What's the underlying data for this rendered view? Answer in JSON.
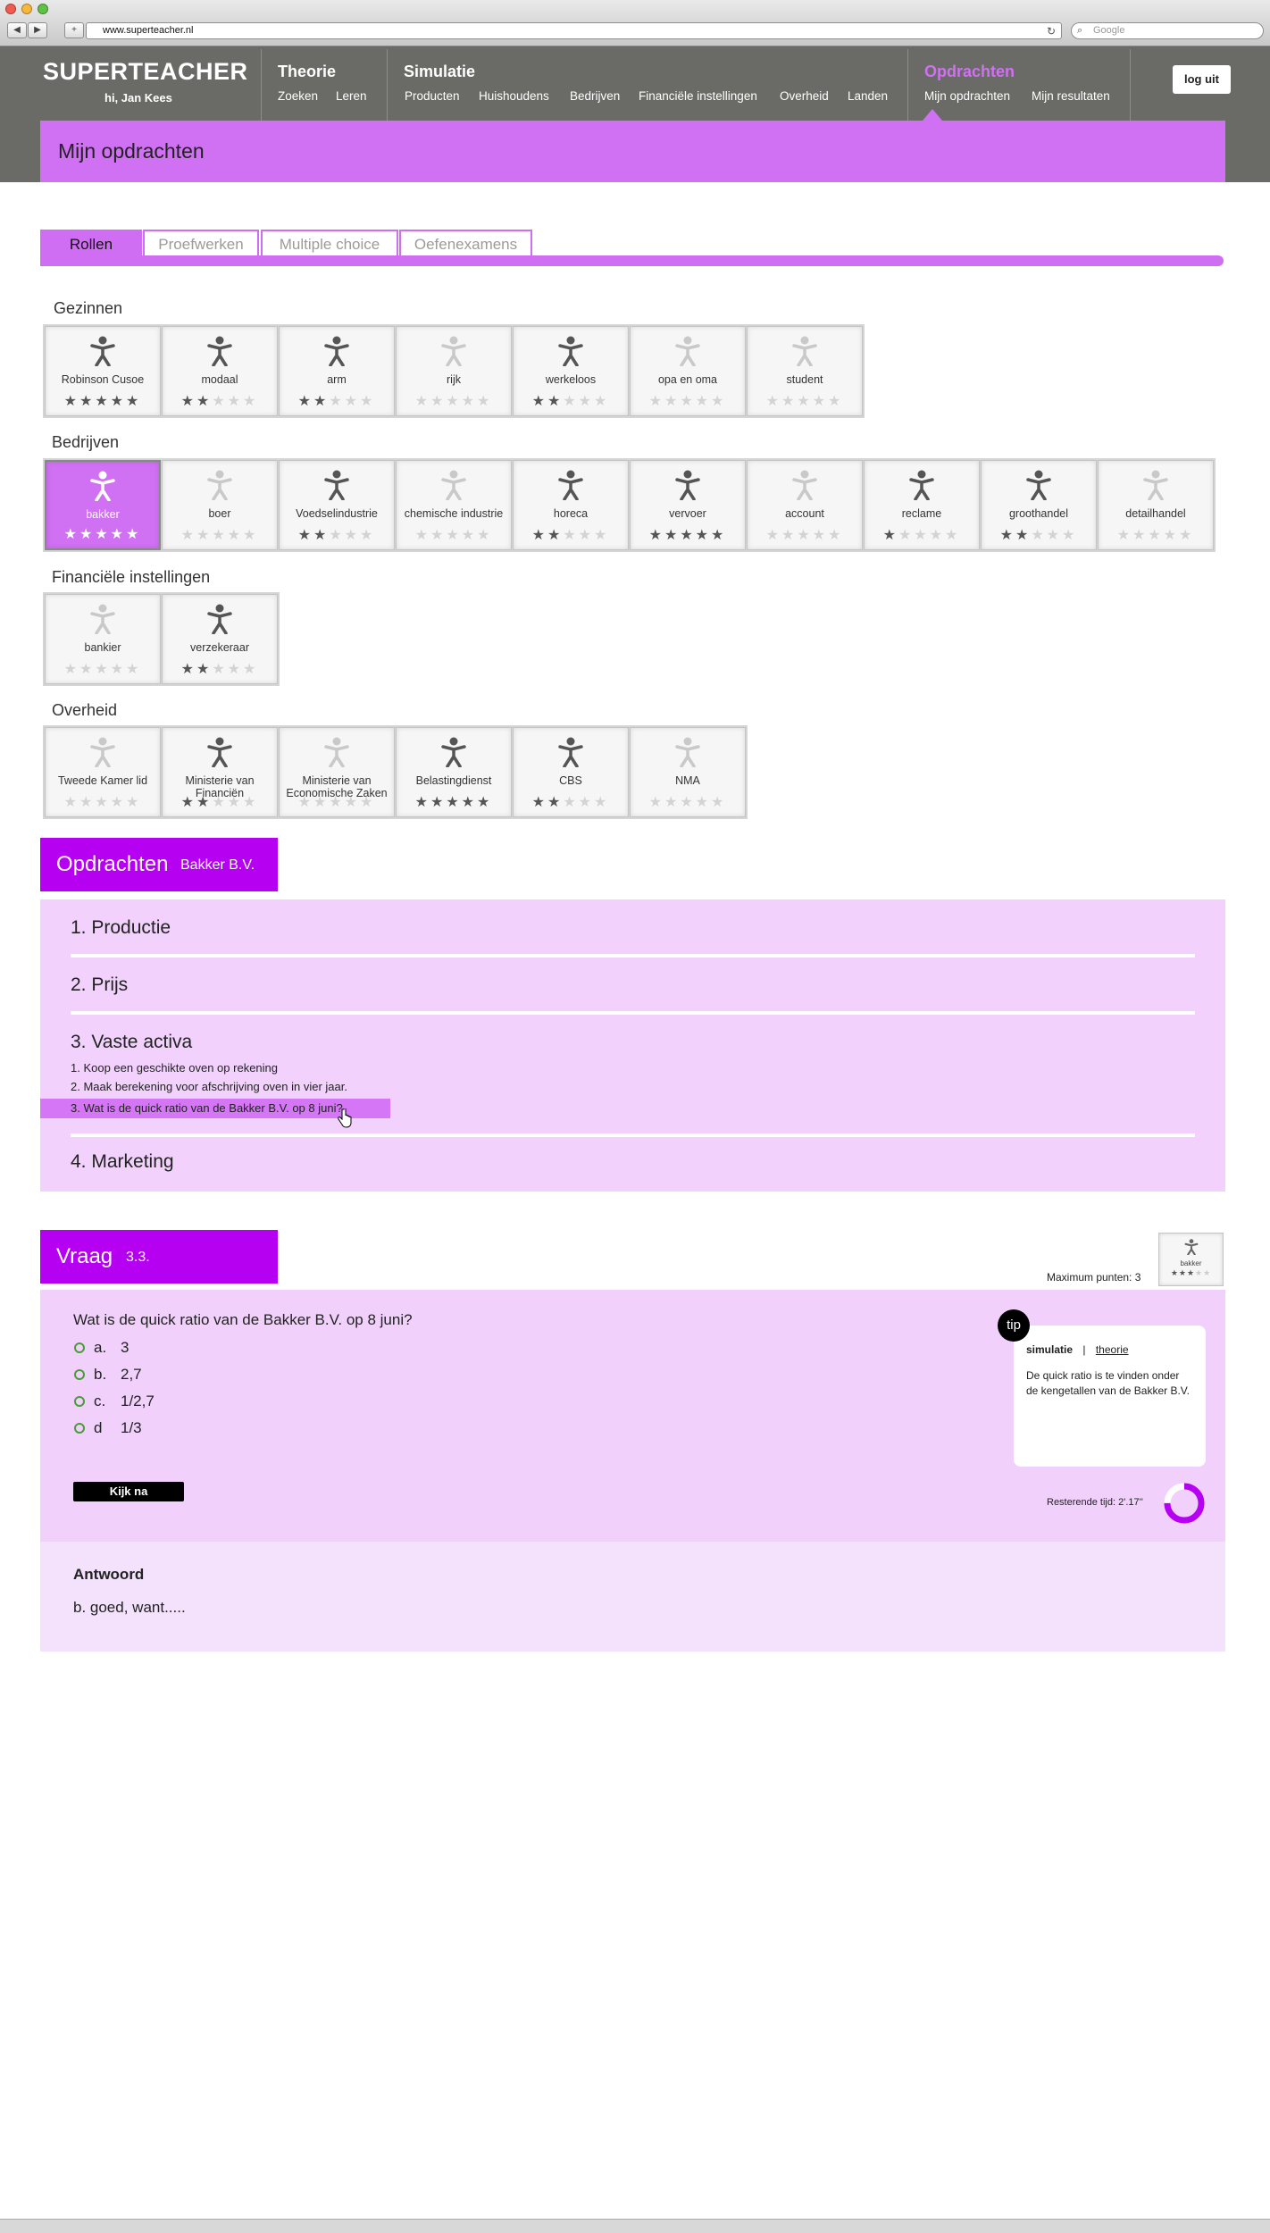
{
  "browser": {
    "url": "www.superteacher.nl",
    "search_placeholder": "Google"
  },
  "header": {
    "logo": "SUPERTEACHER",
    "greeting": "hi, Jan Kees",
    "sections": [
      {
        "title": "Theorie",
        "links": [
          "Zoeken",
          "Leren"
        ]
      },
      {
        "title": "Simulatie",
        "links": [
          "Producten",
          "Huishoudens",
          "Bedrijven",
          "Financiële instellingen",
          "Overheid",
          "Landen"
        ]
      },
      {
        "title": "Opdrachten",
        "links": [
          "Mijn opdrachten",
          "Mijn resultaten"
        ]
      }
    ],
    "logout": "log uit",
    "page_title": "Mijn opdrachten",
    "accent": "#d070f2"
  },
  "tabs": [
    "Rollen",
    "Proefwerken",
    "Multiple choice",
    "Oefenexamens"
  ],
  "groups": [
    {
      "label": "Gezinnen",
      "cards": [
        {
          "name": "Robinson Cusoe",
          "stars": 5
        },
        {
          "name": "modaal",
          "stars": 2
        },
        {
          "name": "arm",
          "stars": 2
        },
        {
          "name": "rijk",
          "stars": 0
        },
        {
          "name": "werkeloos",
          "stars": 2
        },
        {
          "name": "opa en oma",
          "stars": 0
        },
        {
          "name": "student",
          "stars": 0
        }
      ]
    },
    {
      "label": "Bedrijven",
      "cards": [
        {
          "name": "bakker",
          "stars": 5,
          "selected": true
        },
        {
          "name": "boer",
          "stars": 0
        },
        {
          "name": "Voedselindustrie",
          "stars": 2
        },
        {
          "name": "chemische industrie",
          "stars": 0
        },
        {
          "name": "horeca",
          "stars": 2
        },
        {
          "name": "vervoer",
          "stars": 5
        },
        {
          "name": "account",
          "stars": 0
        },
        {
          "name": "reclame",
          "stars": 1
        },
        {
          "name": "groothandel",
          "stars": 2
        },
        {
          "name": "detailhandel",
          "stars": 0
        }
      ]
    },
    {
      "label": "Financiële instellingen",
      "cards": [
        {
          "name": "bankier",
          "stars": 0
        },
        {
          "name": "verzekeraar",
          "stars": 2
        }
      ]
    },
    {
      "label": "Overheid",
      "cards": [
        {
          "name": "Tweede Kamer lid",
          "stars": 0
        },
        {
          "name": "Ministerie van Financiën",
          "stars": 2
        },
        {
          "name": "Ministerie van Economische Zaken",
          "stars": 0
        },
        {
          "name": "Belastingdienst",
          "stars": 5
        },
        {
          "name": "CBS",
          "stars": 2
        },
        {
          "name": "NMA",
          "stars": 0
        }
      ]
    }
  ],
  "assignments": {
    "heading": "Opdrachten",
    "company": "Bakker B.V.",
    "items": [
      "1. Productie",
      "2. Prijs",
      "3. Vaste activa",
      "4. Marketing"
    ],
    "subitems": [
      "1. Koop een geschikte oven op rekening",
      "2. Maak berekening voor afschrijving oven in vier jaar.",
      "3. Wat is de quick ratio van de Bakker B.V. op 8 juni?"
    ]
  },
  "question": {
    "heading": "Vraag",
    "number": "3.3.",
    "max_points": "Maximum punten: 3",
    "badge_name": "bakker",
    "text": "Wat is de quick ratio van de Bakker B.V. op 8 juni?",
    "options": [
      {
        "key": "a.",
        "value": "3"
      },
      {
        "key": "b.",
        "value": "2,7"
      },
      {
        "key": "c.",
        "value": "1/2,7"
      },
      {
        "key": "d",
        "value": "1/3"
      }
    ],
    "check_button": "Kijk na",
    "tip": {
      "label": "tip",
      "tab_active": "simulatie",
      "tab_sep": "|",
      "tab_other": "theorie",
      "text": "De quick ratio is te vinden onder de kengetallen van de Bakker B.V."
    },
    "remaining_time": "Resterende tijd: 2'.17''",
    "timer_fraction": 0.75
  },
  "answer": {
    "heading": "Antwoord",
    "text": "b. goed, want....."
  }
}
